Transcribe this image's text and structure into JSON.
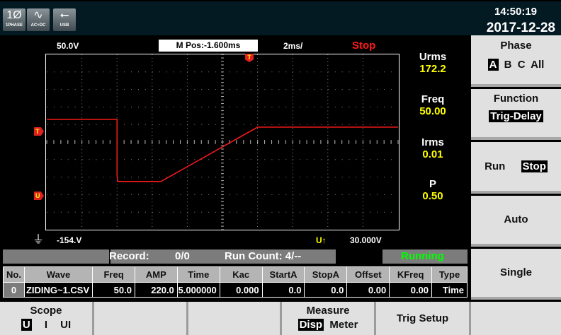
{
  "status_icons": [
    {
      "glyph": "1Ø",
      "label": "1PHASE",
      "name": "phase-icon"
    },
    {
      "glyph": "∿",
      "label": "AC+DC",
      "name": "acdc-icon"
    },
    {
      "glyph": "⭠",
      "label": "USB",
      "name": "usb-icon"
    }
  ],
  "clock": {
    "time": "14:50:19",
    "date": "2017-12-28"
  },
  "scope": {
    "volt_div": "50.0V",
    "m_pos": "M Pos:-1.600ms",
    "time_div": "2ms/",
    "state": "Stop",
    "offset": "-154.V",
    "trigger_src": "U↑",
    "trigger_level": "30.000V",
    "marker_t": "T",
    "marker_u": "U"
  },
  "measurements": [
    {
      "label": "Urms",
      "value": "172.2"
    },
    {
      "label": "Freq",
      "value": "50.00"
    },
    {
      "label": "Irms",
      "value": "0.01"
    },
    {
      "label": "P",
      "value": "0.50"
    }
  ],
  "right_menu": {
    "phase": {
      "title": "Phase",
      "options": [
        "A",
        "B",
        "C",
        "All"
      ]
    },
    "function": {
      "title": "Function",
      "value": "Trig-Delay"
    },
    "runstop": {
      "run": "Run",
      "stop": "Stop"
    },
    "auto": "Auto",
    "single": "Single"
  },
  "record_bar": {
    "record_label": "Record:",
    "record_value": "0/0",
    "run_count": "Run Count: 4/--",
    "status": "Running"
  },
  "table": {
    "headers": [
      "No.",
      "Wave",
      "Freq",
      "AMP",
      "Time",
      "Kac",
      "StartA",
      "StopA",
      "Offset",
      "KFreq",
      "Type"
    ],
    "rows": [
      [
        "0",
        "ZIDING~1.CSV",
        "50.0",
        "220.0",
        "5.000000",
        "0.000",
        "0.0",
        "0.0",
        "0.00",
        "0.00",
        "Time"
      ]
    ]
  },
  "bottom_menu": {
    "scope": {
      "title": "Scope",
      "options": [
        "U",
        "I",
        "UI"
      ]
    },
    "measure": {
      "title": "Measure",
      "options": [
        "Disp",
        "Meter"
      ]
    },
    "trig_setup": "Trig Setup"
  },
  "waveform": {
    "time_ms": [
      0,
      4,
      4,
      4.05,
      6.5,
      12,
      20
    ],
    "divisions": "10x10",
    "values_div": [
      1.3,
      1.3,
      -1.9,
      -2.25,
      -2.25,
      0.85,
      0.85
    ]
  },
  "colors": {
    "trace": "#ff1a1a",
    "value": "#ffff00",
    "running": "#00ff00"
  }
}
